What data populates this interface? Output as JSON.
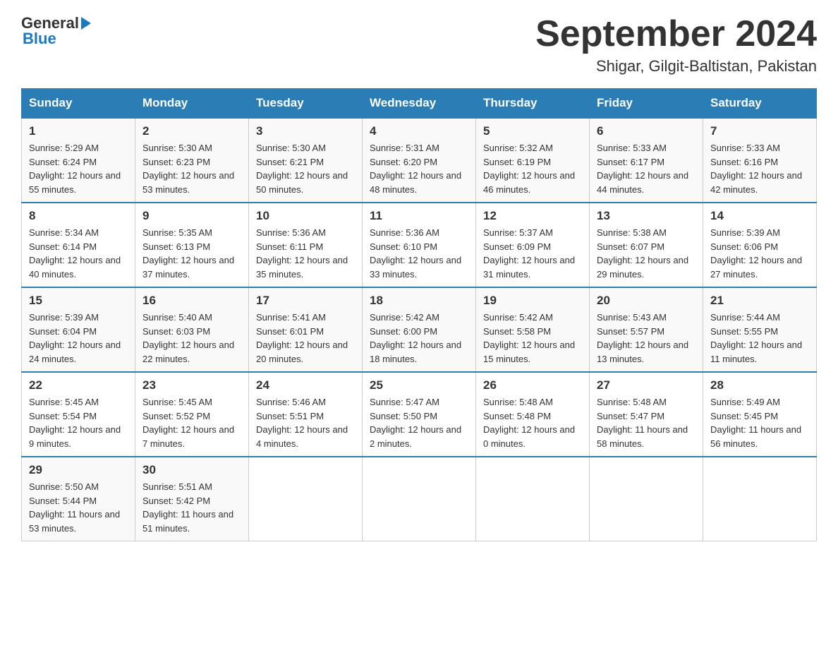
{
  "logo": {
    "text_general": "General",
    "text_blue": "Blue",
    "triangle": "▶"
  },
  "title": "September 2024",
  "subtitle": "Shigar, Gilgit-Baltistan, Pakistan",
  "calendar": {
    "headers": [
      "Sunday",
      "Monday",
      "Tuesday",
      "Wednesday",
      "Thursday",
      "Friday",
      "Saturday"
    ],
    "weeks": [
      [
        {
          "day": "1",
          "sunrise": "5:29 AM",
          "sunset": "6:24 PM",
          "daylight": "12 hours and 55 minutes."
        },
        {
          "day": "2",
          "sunrise": "5:30 AM",
          "sunset": "6:23 PM",
          "daylight": "12 hours and 53 minutes."
        },
        {
          "day": "3",
          "sunrise": "5:30 AM",
          "sunset": "6:21 PM",
          "daylight": "12 hours and 50 minutes."
        },
        {
          "day": "4",
          "sunrise": "5:31 AM",
          "sunset": "6:20 PM",
          "daylight": "12 hours and 48 minutes."
        },
        {
          "day": "5",
          "sunrise": "5:32 AM",
          "sunset": "6:19 PM",
          "daylight": "12 hours and 46 minutes."
        },
        {
          "day": "6",
          "sunrise": "5:33 AM",
          "sunset": "6:17 PM",
          "daylight": "12 hours and 44 minutes."
        },
        {
          "day": "7",
          "sunrise": "5:33 AM",
          "sunset": "6:16 PM",
          "daylight": "12 hours and 42 minutes."
        }
      ],
      [
        {
          "day": "8",
          "sunrise": "5:34 AM",
          "sunset": "6:14 PM",
          "daylight": "12 hours and 40 minutes."
        },
        {
          "day": "9",
          "sunrise": "5:35 AM",
          "sunset": "6:13 PM",
          "daylight": "12 hours and 37 minutes."
        },
        {
          "day": "10",
          "sunrise": "5:36 AM",
          "sunset": "6:11 PM",
          "daylight": "12 hours and 35 minutes."
        },
        {
          "day": "11",
          "sunrise": "5:36 AM",
          "sunset": "6:10 PM",
          "daylight": "12 hours and 33 minutes."
        },
        {
          "day": "12",
          "sunrise": "5:37 AM",
          "sunset": "6:09 PM",
          "daylight": "12 hours and 31 minutes."
        },
        {
          "day": "13",
          "sunrise": "5:38 AM",
          "sunset": "6:07 PM",
          "daylight": "12 hours and 29 minutes."
        },
        {
          "day": "14",
          "sunrise": "5:39 AM",
          "sunset": "6:06 PM",
          "daylight": "12 hours and 27 minutes."
        }
      ],
      [
        {
          "day": "15",
          "sunrise": "5:39 AM",
          "sunset": "6:04 PM",
          "daylight": "12 hours and 24 minutes."
        },
        {
          "day": "16",
          "sunrise": "5:40 AM",
          "sunset": "6:03 PM",
          "daylight": "12 hours and 22 minutes."
        },
        {
          "day": "17",
          "sunrise": "5:41 AM",
          "sunset": "6:01 PM",
          "daylight": "12 hours and 20 minutes."
        },
        {
          "day": "18",
          "sunrise": "5:42 AM",
          "sunset": "6:00 PM",
          "daylight": "12 hours and 18 minutes."
        },
        {
          "day": "19",
          "sunrise": "5:42 AM",
          "sunset": "5:58 PM",
          "daylight": "12 hours and 15 minutes."
        },
        {
          "day": "20",
          "sunrise": "5:43 AM",
          "sunset": "5:57 PM",
          "daylight": "12 hours and 13 minutes."
        },
        {
          "day": "21",
          "sunrise": "5:44 AM",
          "sunset": "5:55 PM",
          "daylight": "12 hours and 11 minutes."
        }
      ],
      [
        {
          "day": "22",
          "sunrise": "5:45 AM",
          "sunset": "5:54 PM",
          "daylight": "12 hours and 9 minutes."
        },
        {
          "day": "23",
          "sunrise": "5:45 AM",
          "sunset": "5:52 PM",
          "daylight": "12 hours and 7 minutes."
        },
        {
          "day": "24",
          "sunrise": "5:46 AM",
          "sunset": "5:51 PM",
          "daylight": "12 hours and 4 minutes."
        },
        {
          "day": "25",
          "sunrise": "5:47 AM",
          "sunset": "5:50 PM",
          "daylight": "12 hours and 2 minutes."
        },
        {
          "day": "26",
          "sunrise": "5:48 AM",
          "sunset": "5:48 PM",
          "daylight": "12 hours and 0 minutes."
        },
        {
          "day": "27",
          "sunrise": "5:48 AM",
          "sunset": "5:47 PM",
          "daylight": "11 hours and 58 minutes."
        },
        {
          "day": "28",
          "sunrise": "5:49 AM",
          "sunset": "5:45 PM",
          "daylight": "11 hours and 56 minutes."
        }
      ],
      [
        {
          "day": "29",
          "sunrise": "5:50 AM",
          "sunset": "5:44 PM",
          "daylight": "11 hours and 53 minutes."
        },
        {
          "day": "30",
          "sunrise": "5:51 AM",
          "sunset": "5:42 PM",
          "daylight": "11 hours and 51 minutes."
        },
        null,
        null,
        null,
        null,
        null
      ]
    ]
  }
}
